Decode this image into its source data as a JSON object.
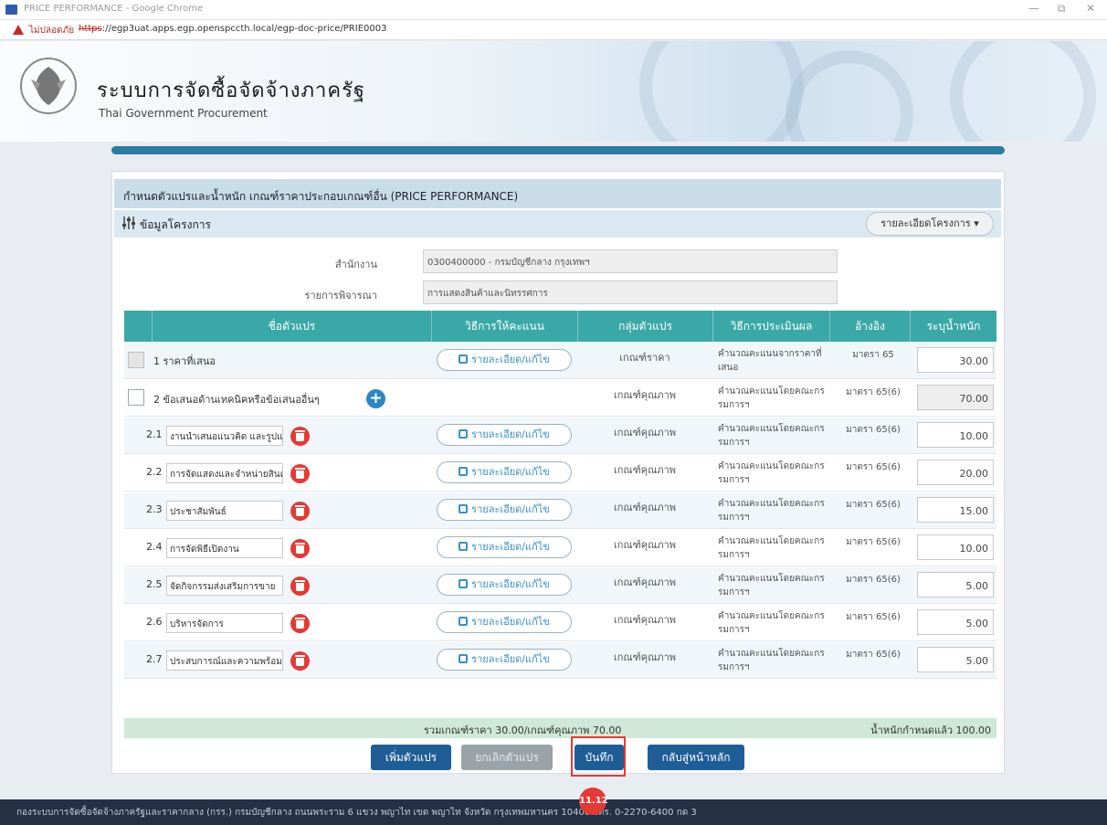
{
  "window": {
    "title": "PRICE PERFORMANCE - Google Chrome",
    "minimize": "—",
    "restore": "⧉",
    "close": "✕"
  },
  "address": {
    "insecure_label": "ไม่ปลอดภัย",
    "separator": "|",
    "url_scheme": "https",
    "url_rest": "://egp3uat.apps.egp.openspccth.local/egp-doc-price/PRIE0003"
  },
  "site": {
    "title": "ระบบการจัดซื้อจัดจ้างภาครัฐ",
    "subtitle": "Thai Government Procurement"
  },
  "form": {
    "section_title": "กำหนดตัวแปรและน้ำหนัก เกณฑ์ราคาประกอบเกณฑ์อื่น (PRICE PERFORMANCE)",
    "info_title": "ข้อมูลโครงการ",
    "details_button": "รายละเอียดโครงการ ▾",
    "agency_label": "สำนักงาน",
    "agency_value": "0300400000 - กรมบัญชีกลาง กรุงเทพฯ",
    "consider_label": "รายการพิจารณา",
    "consider_value": "การแสดงสินค้าและนิทรรศการ"
  },
  "table": {
    "headers": {
      "name": "ชื่อตัวแปร",
      "scoring": "วิธีการให้คะแนน",
      "group": "กลุ่มตัวแปร",
      "method": "วิธีการประเมินผล",
      "ref": "อ้างอิง",
      "weight": "ระบุน้ำหนัก"
    },
    "edit_label": "รายละเอียด/แก้ไข",
    "rows": [
      {
        "name": "1 ราคาที่เสนอ",
        "group": "เกณฑ์ราคา",
        "method": "คำนวณคะแนนจากราคาที่เสนอ",
        "ref": "มาตรา 65",
        "weight": "30.00"
      },
      {
        "name": "2 ข้อเสนอด้านเทคนิคหรือข้อเสนออื่นๆ",
        "group": "เกณฑ์คุณภาพ",
        "method": "คำนวณคะแนนโดยคณะกรรมการฯ",
        "ref": "มาตรา 65(6)",
        "weight": "70.00"
      },
      {
        "num": "2.1",
        "name": "งานนำเสนอแนวคิด และรูปแบบ",
        "group": "เกณฑ์คุณภาพ",
        "method": "คำนวณคะแนนโดยคณะกรรมการฯ",
        "ref": "มาตรา 65(6)",
        "weight": "10.00"
      },
      {
        "num": "2.2",
        "name": "การจัดแสดงและจำหน่ายสินค้า",
        "group": "เกณฑ์คุณภาพ",
        "method": "คำนวณคะแนนโดยคณะกรรมการฯ",
        "ref": "มาตรา 65(6)",
        "weight": "20.00"
      },
      {
        "num": "2.3",
        "name": "ประชาสัมพันธ์",
        "group": "เกณฑ์คุณภาพ",
        "method": "คำนวณคะแนนโดยคณะกรรมการฯ",
        "ref": "มาตรา 65(6)",
        "weight": "15.00"
      },
      {
        "num": "2.4",
        "name": "การจัดพิธีเปิดงาน",
        "group": "เกณฑ์คุณภาพ",
        "method": "คำนวณคะแนนโดยคณะกรรมการฯ",
        "ref": "มาตรา 65(6)",
        "weight": "10.00"
      },
      {
        "num": "2.5",
        "name": "จัดกิจกรรมส่งเสริมการขาย",
        "group": "เกณฑ์คุณภาพ",
        "method": "คำนวณคะแนนโดยคณะกรรมการฯ",
        "ref": "มาตรา 65(6)",
        "weight": "5.00"
      },
      {
        "num": "2.6",
        "name": "บริหารจัดการ",
        "group": "เกณฑ์คุณภาพ",
        "method": "คำนวณคะแนนโดยคณะกรรมการฯ",
        "ref": "มาตรา 65(6)",
        "weight": "5.00"
      },
      {
        "num": "2.7",
        "name": "ประสบการณ์และความพร้อมใน",
        "group": "เกณฑ์คุณภาพ",
        "method": "คำนวณคะแนนโดยคณะกรรมการฯ",
        "ref": "มาตรา 65(6)",
        "weight": "5.00"
      }
    ],
    "summary_left": "รวมเกณฑ์ราคา 30.00/เกณฑ์คุณภาพ 70.00",
    "summary_right": "น้ำหนักกำหนดแล้ว 100.00"
  },
  "actions": {
    "add": "เพิ่มตัวแปร",
    "cancel": "ยกเลิกตัวแปร",
    "save": "บันทึก",
    "back": "กลับสู่หน้าหลัก"
  },
  "step_badge": "11.12",
  "footer": "กองระบบการจัดซื้อจัดจ้างภาครัฐและราคากลาง (กรร.) กรมบัญชีกลาง ถนนพระราม 6 แขวง พญาไท เขต พญาไท จังหวัด กรุงเทพมหานคร 10400 โทร. 0-2270-6400 กด 3"
}
